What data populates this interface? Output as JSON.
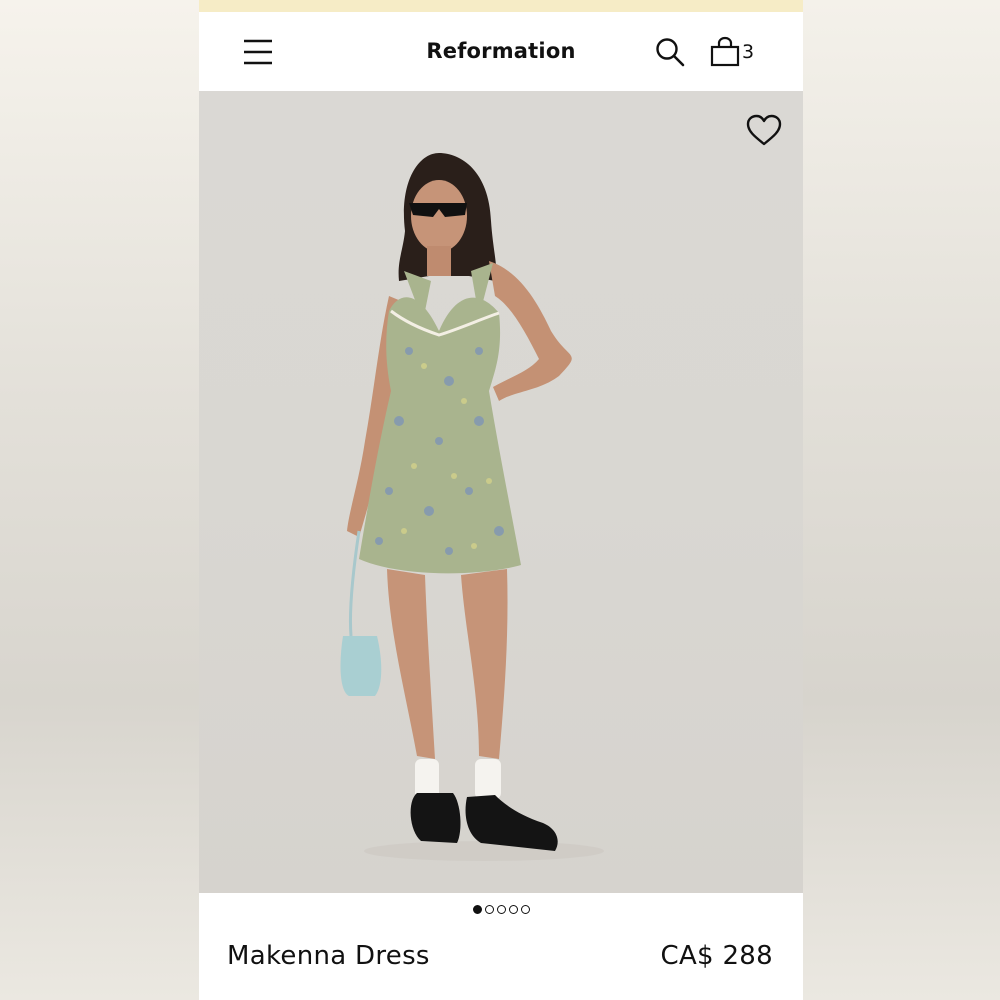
{
  "header": {
    "brand": "Reformation",
    "cart_count": "3",
    "icons": {
      "menu": "hamburger-menu-icon",
      "search": "search-icon",
      "cart": "shopping-bag-icon"
    }
  },
  "product": {
    "name": "Makenna Dress",
    "price": "CA$ 288",
    "wishlist_icon": "heart-icon",
    "image_count": 5,
    "active_image_index": 0
  },
  "colors": {
    "promo_strip": "#f6ecc6",
    "image_background": "#dad8d4",
    "dress": "#a9b48e",
    "text": "#111111"
  }
}
